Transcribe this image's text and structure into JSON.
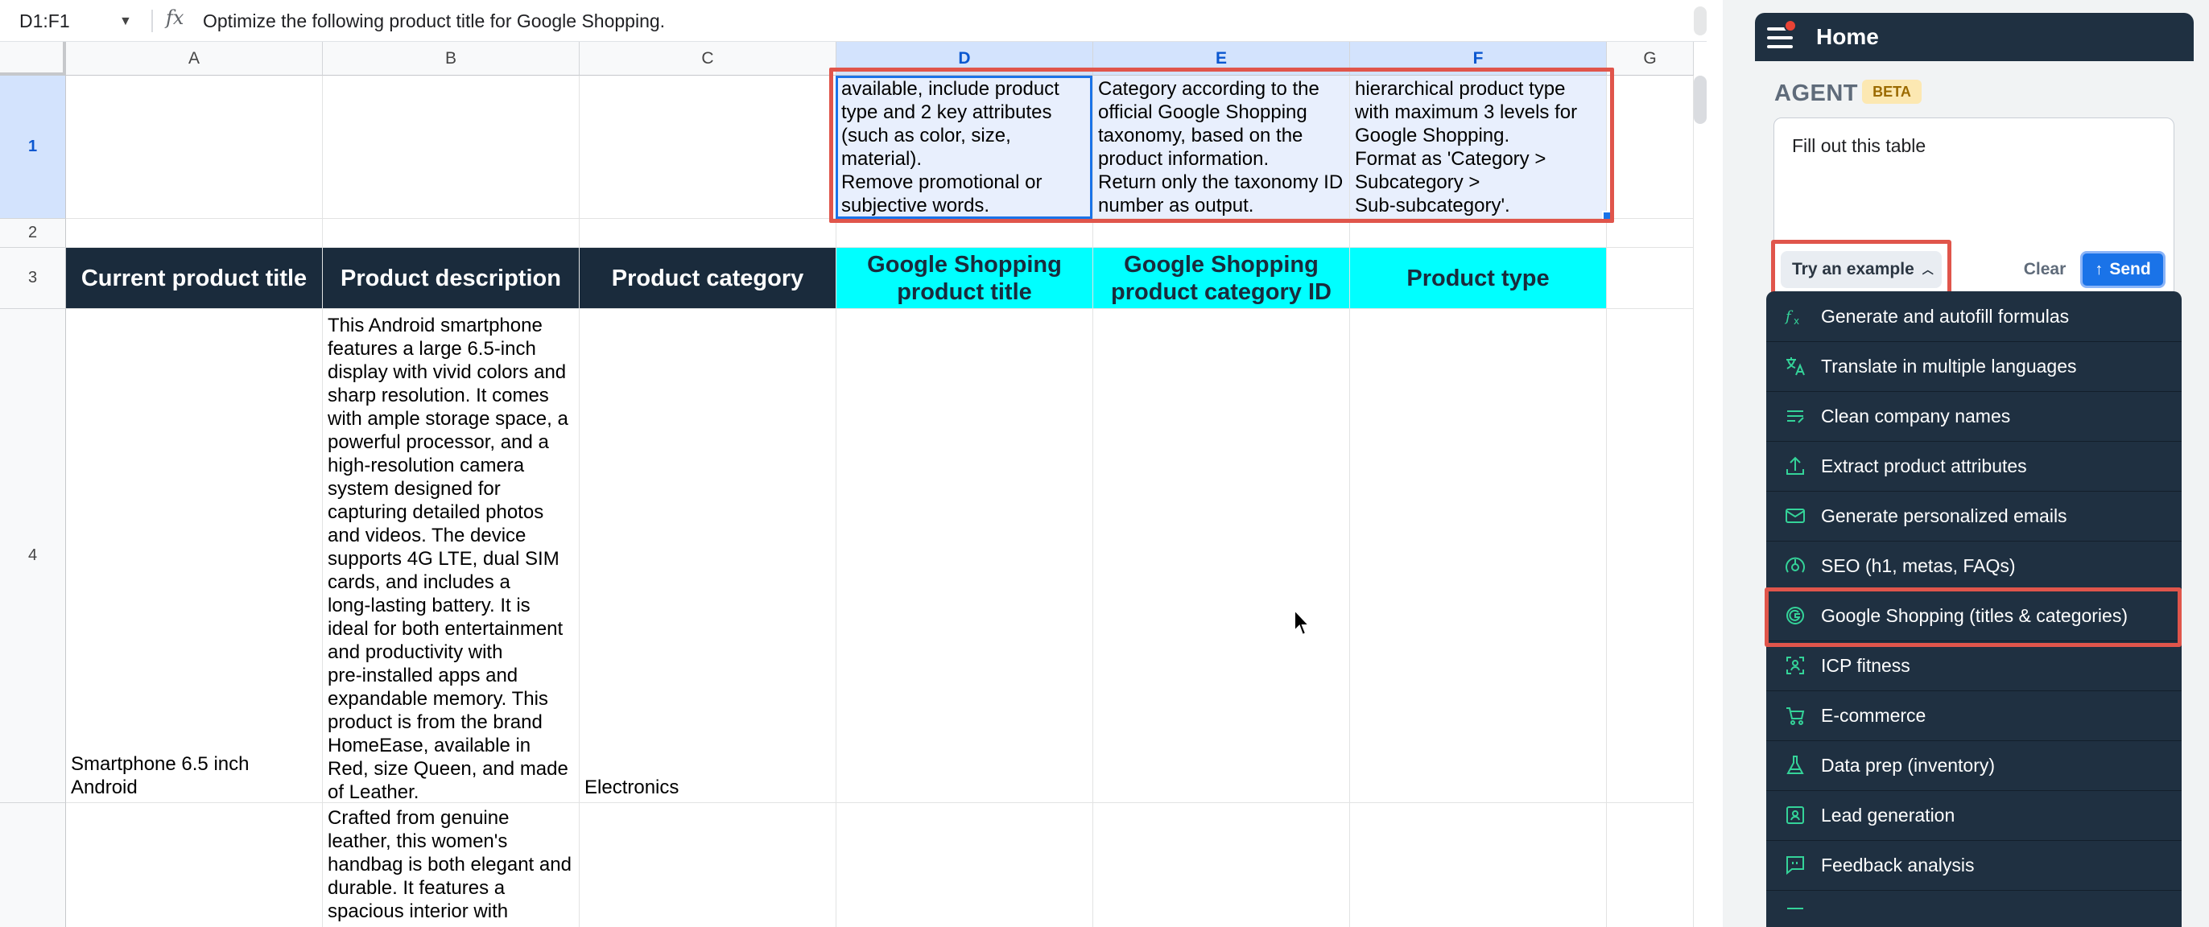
{
  "formula_bar": {
    "name_box": "D1:F1",
    "formula": "Optimize the following product title for Google Shopping."
  },
  "columns": [
    "A",
    "B",
    "C",
    "D",
    "E",
    "F",
    "G"
  ],
  "rows": [
    "1",
    "2",
    "3",
    "4"
  ],
  "row1": {
    "D": "available, include product\ntype and 2 key attributes\n(such as color, size,\nmaterial).\nRemove promotional or\nsubjective words.",
    "E": "Category according to the\nofficial Google Shopping\ntaxonomy, based on the\nproduct information.\nReturn only the taxonomy ID\nnumber as output.",
    "F": "hierarchical product type\nwith maximum 3 levels for\nGoogle Shopping.\nFormat as 'Category >\nSubcategory >\nSub-subcategory'."
  },
  "headers": {
    "A": "Current product title",
    "B": "Product description",
    "C": "Product category",
    "D": "Google Shopping product title",
    "E": "Google Shopping product category ID",
    "F": "Product type"
  },
  "row4": {
    "A": "Smartphone 6.5 inch\nAndroid",
    "B": "This Android smartphone\nfeatures a large 6.5-inch\ndisplay with vivid colors and\nsharp resolution. It comes\nwith ample storage space, a\npowerful processor, and a\nhigh-resolution camera\nsystem designed for\ncapturing detailed photos\nand videos. The device\nsupports 4G LTE, dual SIM\ncards, and includes a\nlong-lasting battery. It is\nideal for both entertainment\nand productivity with\npre-installed apps and\nexpandable memory. This\nproduct is from the brand\nHomeEase, available in\nRed, size Queen, and made\nof Leather.",
    "C": "Electronics"
  },
  "row5": {
    "B": "Crafted from genuine\nleather, this women's\nhandbag is both elegant and\ndurable. It features a\nspacious interior with"
  },
  "sidebar": {
    "title": "Home",
    "agent_label": "AGENT",
    "beta_badge": "BETA",
    "prompt_text": "Fill out this table",
    "try_example_label": "Try an example",
    "clear_label": "Clear",
    "send_label": "Send",
    "examples": [
      {
        "label": "Generate and autofill formulas",
        "icon": "function-icon"
      },
      {
        "label": "Translate in multiple languages",
        "icon": "translate-icon"
      },
      {
        "label": "Clean company names",
        "icon": "clean-list-icon"
      },
      {
        "label": "Extract product attributes",
        "icon": "extract-icon"
      },
      {
        "label": "Generate personalized emails",
        "icon": "email-icon"
      },
      {
        "label": "SEO (h1, metas, FAQs)",
        "icon": "seo-gauge-icon"
      },
      {
        "label": "Google Shopping (titles & categories)",
        "icon": "google-icon"
      },
      {
        "label": "ICP fitness",
        "icon": "person-search-icon"
      },
      {
        "label": "E-commerce",
        "icon": "cart-icon"
      },
      {
        "label": "Data prep (inventory)",
        "icon": "flask-icon"
      },
      {
        "label": "Lead generation",
        "icon": "contact-card-icon"
      },
      {
        "label": "Feedback analysis",
        "icon": "feedback-icon"
      }
    ]
  },
  "colors": {
    "header_dark": "#1a2b3c",
    "header_cyan": "#00ffff",
    "highlight": "#e0554b",
    "accent": "#1a73e8",
    "menu_bg": "#1f3041",
    "icon_green": "#34d399"
  }
}
